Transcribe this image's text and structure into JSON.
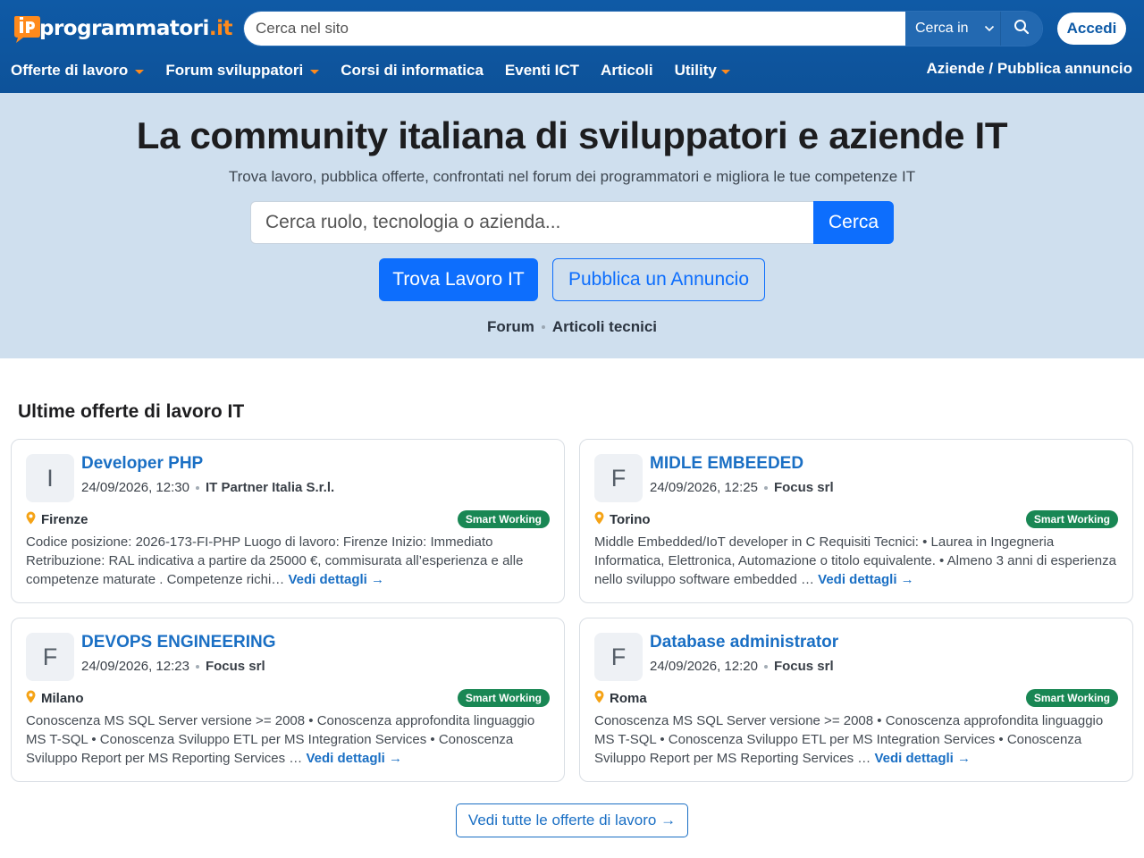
{
  "brand": {
    "logo_text_main": "programmatori",
    "logo_text_tld": ".it",
    "accent": "#ff8a1c",
    "primary": "#0d6efd",
    "header_bg": "#0f5aa6"
  },
  "header": {
    "search_placeholder": "Cerca nel sito",
    "search_scope": "Cerca in",
    "login": "Accedi"
  },
  "nav": {
    "items": [
      {
        "label": "Offerte di lavoro",
        "dropdown": true
      },
      {
        "label": "Forum sviluppatori",
        "dropdown": true
      },
      {
        "label": "Corsi di informatica",
        "dropdown": false
      },
      {
        "label": "Eventi ICT",
        "dropdown": false
      },
      {
        "label": "Articoli",
        "dropdown": false
      },
      {
        "label": "Utility",
        "dropdown": true
      }
    ],
    "right": "Aziende / Pubblica annuncio"
  },
  "hero": {
    "title": "La community italiana di sviluppatori e aziende IT",
    "subtitle": "Trova lavoro, pubblica offerte, confrontati nel forum dei programmatori e migliora le tue competenze IT",
    "search_placeholder": "Cerca ruolo, tecnologia o azienda...",
    "search_button": "Cerca",
    "cta_primary": "Trova Lavoro IT",
    "cta_secondary": "Pubblica un Annuncio",
    "links": [
      "Forum",
      "Articoli tecnici"
    ]
  },
  "jobs": {
    "section_title": "Ultime offerte di lavoro IT",
    "read_more": "Vedi dettagli →",
    "view_all": "Vedi tutte le offerte di lavoro →",
    "items": [
      {
        "initial": "I",
        "title": "Developer PHP",
        "date": "24/09/2026, 12:30",
        "company": "IT Partner Italia S.r.l.",
        "location": "Firenze",
        "badge": "Smart Working",
        "description": "Codice posizione: 2026-173-FI-PHP Luogo di lavoro: Firenze Inizio: Immediato Retribuzione: RAL indicativa a partire da 25000 €, commisurata all’esperienza e alle competenze maturate . Competenze richi…"
      },
      {
        "initial": "F",
        "title": "MIDLE EMBEEDED",
        "date": "24/09/2026, 12:25",
        "company": "Focus srl",
        "location": "Torino",
        "badge": "Smart Working",
        "description": "Middle Embedded/IoT developer in C Requisiti Tecnici: • Laurea in Ingegneria Informatica, Elettronica, Automazione o titolo equivalente. • Almeno 3 anni di esperienza nello sviluppo software embedded …"
      },
      {
        "initial": "F",
        "title": "DEVOPS ENGINEERING",
        "date": "24/09/2026, 12:23",
        "company": "Focus srl",
        "location": "Milano",
        "badge": "Smart Working",
        "description": "Conoscenza MS SQL Server versione >= 2008 • Conoscenza approfondita linguaggio MS T-SQL • Conoscenza Sviluppo ETL per MS Integration Services • Conoscenza Sviluppo Report per MS Reporting Services …"
      },
      {
        "initial": "F",
        "title": "Database administrator",
        "date": "24/09/2026, 12:20",
        "company": "Focus srl",
        "location": "Roma",
        "badge": "Smart Working",
        "description": "Conoscenza MS SQL Server versione >= 2008 • Conoscenza approfondita linguaggio MS T-SQL • Conoscenza Sviluppo ETL per MS Integration Services • Conoscenza Sviluppo Report per MS Reporting Services …"
      }
    ]
  }
}
